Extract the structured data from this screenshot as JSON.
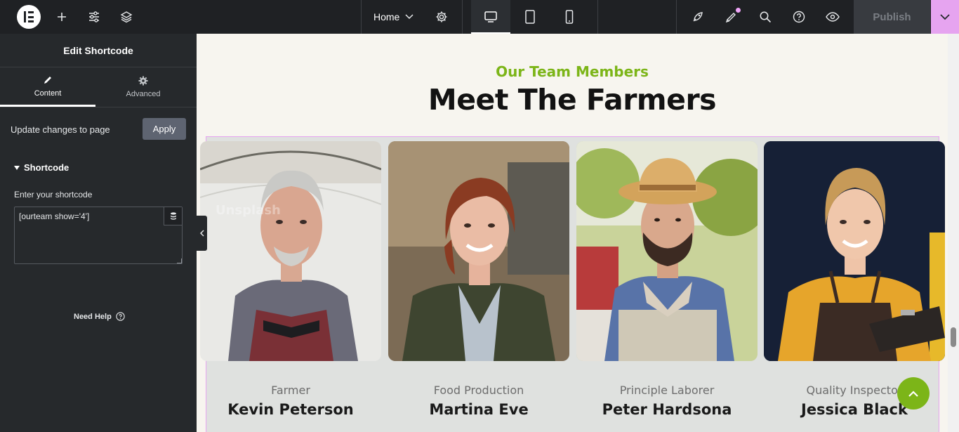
{
  "topbar": {
    "page_name": "Home",
    "publish_label": "Publish",
    "icons": [
      "elementor-logo-icon",
      "add-icon",
      "settings-sliders-icon",
      "layers-icon",
      "page-settings-gear-icon",
      "desktop-icon",
      "tablet-icon",
      "mobile-icon",
      "rocket-icon",
      "whats-new-icon",
      "search-icon",
      "help-icon",
      "preview-eye-icon",
      "chevron-down-icon"
    ]
  },
  "panel": {
    "title": "Edit Shortcode",
    "tabs": [
      {
        "label": "Content",
        "icon": "pencil-icon",
        "active": true
      },
      {
        "label": "Advanced",
        "icon": "gear-icon",
        "active": false
      }
    ],
    "update_label": "Update changes to page",
    "apply_label": "Apply",
    "section_title": "Shortcode",
    "field_label": "Enter your shortcode",
    "field_value": "[ourteam show='4']",
    "need_help": "Need Help"
  },
  "canvas": {
    "subtitle": "Our Team Members",
    "title": "Meet The Farmers",
    "accent_color": "#7cb518",
    "members": [
      {
        "role": "Farmer",
        "name": "Kevin Peterson"
      },
      {
        "role": "Food Production",
        "name": "Martina Eve"
      },
      {
        "role": "Principle Laborer",
        "name": "Peter Hardsona"
      },
      {
        "role": "Quality Inspector",
        "name": "Jessica Black"
      }
    ],
    "watermark": "Unsplash"
  }
}
